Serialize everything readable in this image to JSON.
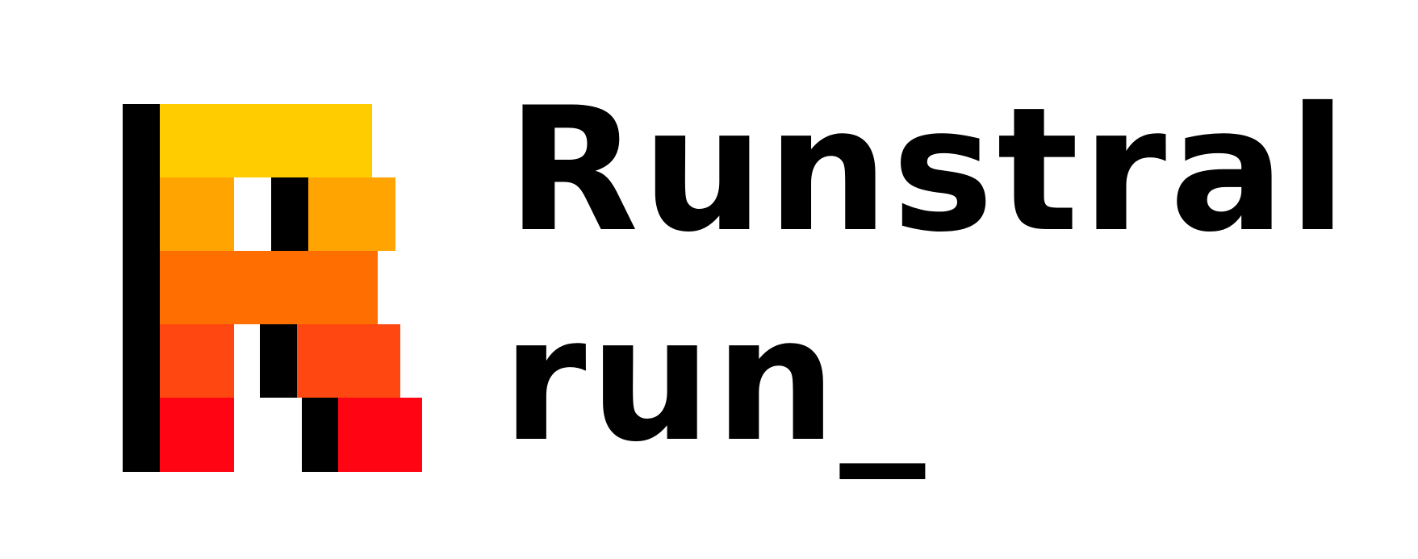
{
  "brand": {
    "line_1": "Runstral",
    "line_2": "run_"
  },
  "colors": {
    "black": "#000000",
    "yellow": "#FFCC00",
    "amber": "#FFA400",
    "orange": "#FF6E00",
    "red_orange": "#FF4711",
    "red": "#FF0513",
    "background": "#FFFFFF"
  }
}
